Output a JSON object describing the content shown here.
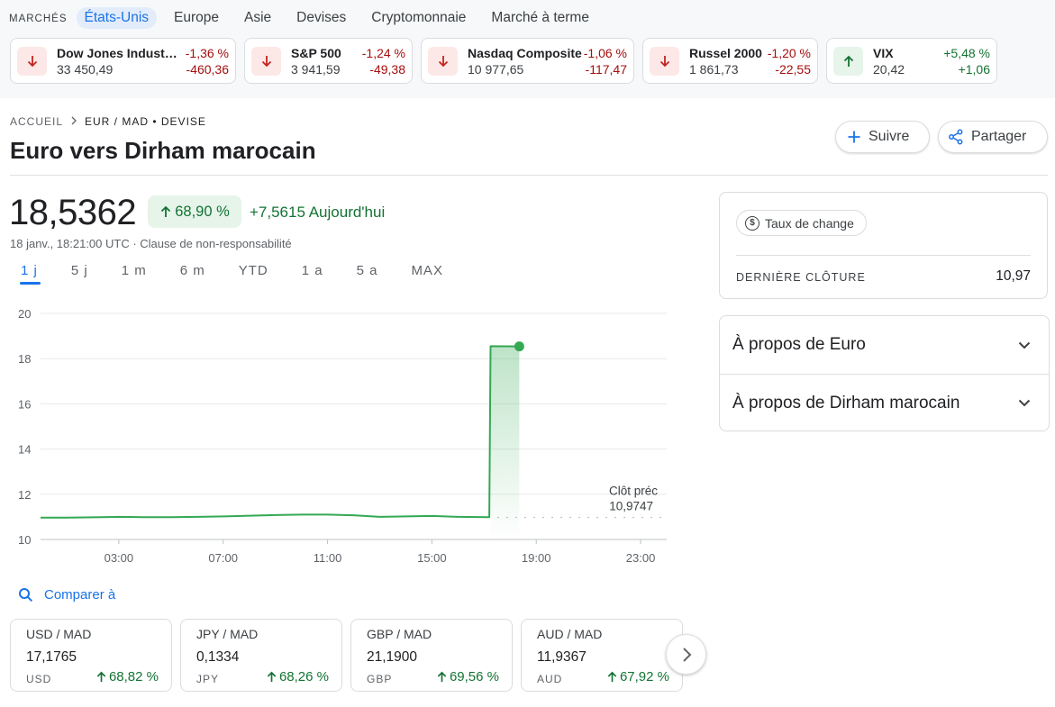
{
  "markets": {
    "label": "MARCHÉS",
    "tabs": [
      "États-Unis",
      "Europe",
      "Asie",
      "Devises",
      "Cryptomonnaie",
      "Marché à terme"
    ],
    "active_tab": 0,
    "tickers": [
      {
        "name": "Dow Jones Industri…",
        "value": "33 450,49",
        "pct": "-1,36 %",
        "change": "-460,36",
        "direction": "down"
      },
      {
        "name": "S&P 500",
        "value": "3 941,59",
        "pct": "-1,24 %",
        "change": "-49,38",
        "direction": "down"
      },
      {
        "name": "Nasdaq Composite",
        "value": "10 977,65",
        "pct": "-1,06 %",
        "change": "-117,47",
        "direction": "down"
      },
      {
        "name": "Russel 2000",
        "value": "1 861,73",
        "pct": "-1,20 %",
        "change": "-22,55",
        "direction": "down"
      },
      {
        "name": "VIX",
        "value": "20,42",
        "pct": "+5,48 %",
        "change": "+1,06",
        "direction": "up"
      }
    ]
  },
  "breadcrumb": {
    "home": "ACCUEIL",
    "current": "EUR / MAD • DEVISE"
  },
  "title": "Euro vers Dirham marocain",
  "actions": {
    "follow": "Suivre",
    "share": "Partager"
  },
  "quote": {
    "price": "18,5362",
    "pct": "68,90 %",
    "today_change": "+7,5615 Aujourd'hui",
    "timestamp": "18 janv., 18:21:00 UTC · Clause de non-responsabilité"
  },
  "ranges": [
    "1 j",
    "5 j",
    "1 m",
    "6 m",
    "YTD",
    "1 a",
    "5 a",
    "MAX"
  ],
  "active_range": 0,
  "chart_data": {
    "type": "line",
    "ylim": [
      10,
      20
    ],
    "y_ticks": [
      20,
      18,
      16,
      14,
      12,
      10
    ],
    "xlim_hours": [
      0,
      24
    ],
    "x_ticks": [
      {
        "label": "03:00",
        "hour": 3
      },
      {
        "label": "07:00",
        "hour": 7
      },
      {
        "label": "11:00",
        "hour": 11
      },
      {
        "label": "15:00",
        "hour": 15
      },
      {
        "label": "19:00",
        "hour": 19
      },
      {
        "label": "23:00",
        "hour": 23
      }
    ],
    "series": [
      {
        "points": [
          [
            0,
            10.97
          ],
          [
            1,
            10.97
          ],
          [
            2,
            10.98
          ],
          [
            3,
            11.0
          ],
          [
            4,
            10.99
          ],
          [
            5,
            10.99
          ],
          [
            6,
            11.0
          ],
          [
            7,
            11.02
          ],
          [
            8,
            11.05
          ],
          [
            9,
            11.08
          ],
          [
            10,
            11.1
          ],
          [
            11,
            11.1
          ],
          [
            12,
            11.07
          ],
          [
            13,
            11.0
          ],
          [
            14,
            11.02
          ],
          [
            15,
            11.04
          ],
          [
            16,
            11.0
          ],
          [
            17.2,
            10.99
          ],
          [
            17.25,
            18.55
          ],
          [
            18.35,
            18.54
          ]
        ]
      }
    ],
    "previous_close": {
      "label": "Clôt préc",
      "value": 10.9747,
      "value_text": "10,9747"
    },
    "line_color": "#34a853",
    "grid": true
  },
  "compare": {
    "label": "Comparer à",
    "cards": [
      {
        "pair": "USD / MAD",
        "value": "17,1765",
        "code": "USD",
        "pct": "68,82 %"
      },
      {
        "pair": "JPY / MAD",
        "value": "0,1334",
        "code": "JPY",
        "pct": "68,26 %"
      },
      {
        "pair": "GBP / MAD",
        "value": "21,1900",
        "code": "GBP",
        "pct": "69,56 %"
      },
      {
        "pair": "AUD / MAD",
        "value": "11,9367",
        "code": "AUD",
        "pct": "67,92 %"
      }
    ]
  },
  "info": {
    "chip": "Taux de change",
    "chip_icon": "$",
    "last_close_label": "DERNIÈRE CLÔTURE",
    "last_close_value": "10,97"
  },
  "about": [
    "À propos de Euro",
    "À propos de Dirham marocain"
  ],
  "colors": {
    "accent": "#1a73e8",
    "positive": "#137333",
    "negative": "#a50e0e",
    "line": "#34a853"
  }
}
